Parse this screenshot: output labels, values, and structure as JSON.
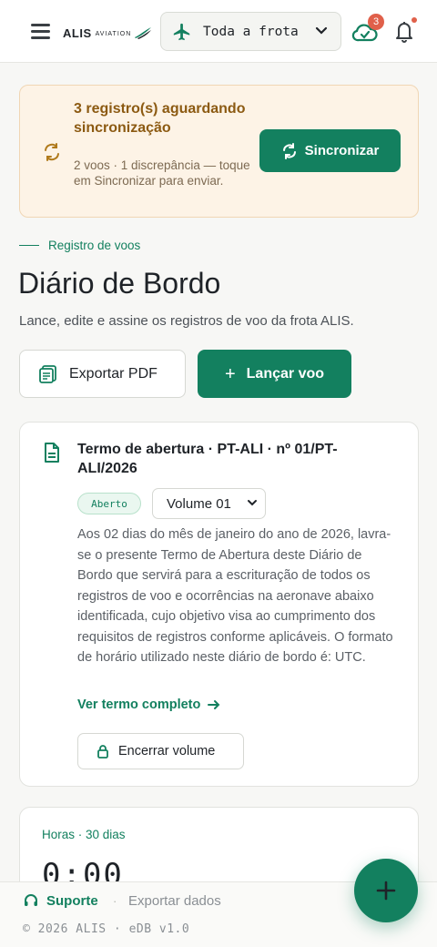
{
  "header": {
    "logo_text": "ALIS",
    "logo_subtext": "AVIATION",
    "fleet_selector": {
      "value": "Toda a frota",
      "icon": "plane-icon"
    },
    "sync_badge_count": "3",
    "notification_dot": true
  },
  "sync_banner": {
    "title": "3 registro(s) aguardando sincronização",
    "description": "2 voos · 1 discrepância — toque em Sincronizar para enviar.",
    "button_label": "Sincronizar"
  },
  "page": {
    "eyebrow": "Registro de voos",
    "title": "Diário de Bordo",
    "subtitle": "Lance, edite e assine os registros de voo da frota ALIS."
  },
  "actions": {
    "export_label": "Exportar PDF",
    "primary_label": "Lançar voo"
  },
  "term_card": {
    "title": "Termo de abertura · PT-ALI · nº 01/PT-ALI/2026",
    "status": "Aberto",
    "volume": "Volume 01",
    "body": "Aos 02 dias do mês de janeiro do ano de 2026, lavra-se o presente Termo de Abertura deste Diário de Bordo que servirá para a escrituração de todos os registros de voo e ocorrências na aeronave abaixo identificada, cujo objetivo visa ao cumprimento dos requisitos de registros conforme aplicáveis. O formato de horário utilizado neste diário de bordo é: UTC.",
    "link_label": "Ver termo completo",
    "close_button_label": "Encerrar volume"
  },
  "hours_card": {
    "label": "Horas · 30 dias",
    "value": "0:00"
  },
  "footer": {
    "support_label": "Suporte",
    "separator": "·",
    "export_label": "Exportar dados",
    "copyright": "© 2026 ALIS · eDB v1.0"
  },
  "colors": {
    "accent": "#13805f",
    "banner_bg": "#fdf3e6",
    "badge_red": "#e0604a"
  }
}
